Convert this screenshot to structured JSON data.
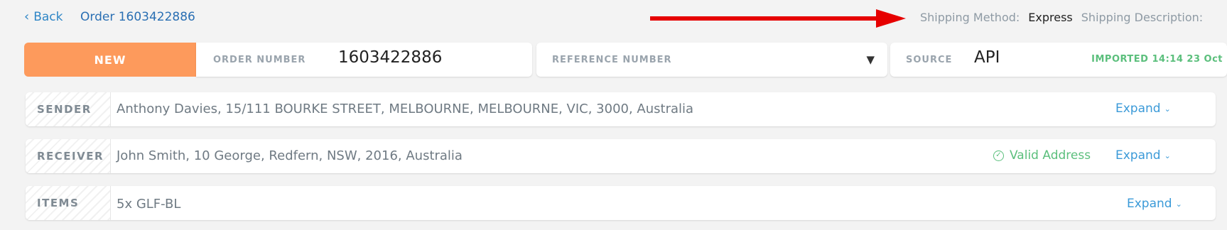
{
  "header": {
    "back_label": "Back",
    "order_title": "Order 1603422886",
    "shipping_method_label": "Shipping Method:",
    "shipping_method_value": "Express",
    "shipping_description_label": "Shipping Description:"
  },
  "status": {
    "badge": "NEW",
    "order_number_label": "ORDER NUMBER",
    "order_number_value": "1603422886",
    "reference_number_label": "REFERENCE NUMBER",
    "source_label": "SOURCE",
    "source_value": "API",
    "imported_text": "IMPORTED 14:14 23 Oct"
  },
  "sections": {
    "sender": {
      "tag": "SENDER",
      "text": "Anthony Davies, 15/111 BOURKE STREET, MELBOURNE, MELBOURNE, VIC, 3000, Australia",
      "expand": "Expand"
    },
    "receiver": {
      "tag": "RECEIVER",
      "text": "John Smith, 10 George, Redfern, NSW, 2016, Australia",
      "valid": "Valid Address",
      "expand": "Expand"
    },
    "items": {
      "tag": "ITEMS",
      "text": "5x GLF-BL",
      "expand": "Expand"
    }
  },
  "colors": {
    "accent_blue": "#2f86c6",
    "status_new": "#fd9a5c",
    "valid_green": "#5bbf7c",
    "arrow_red": "#e60000"
  }
}
